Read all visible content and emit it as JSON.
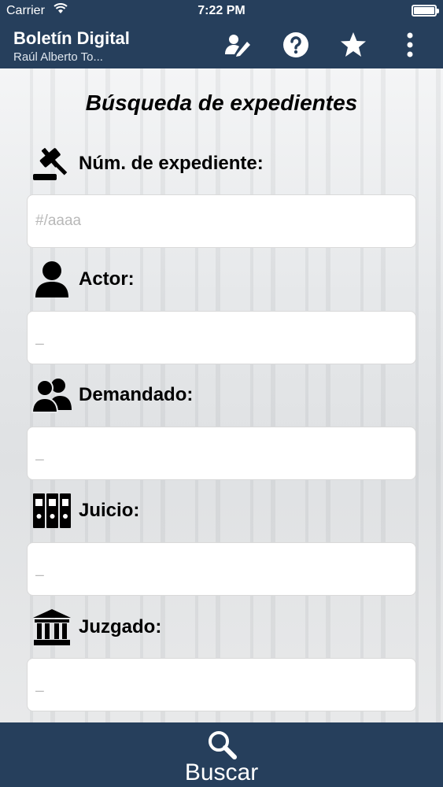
{
  "status_bar": {
    "carrier": "Carrier",
    "time": "7:22 PM"
  },
  "header": {
    "title": "Boletín Digital",
    "subtitle": "Raúl Alberto To...",
    "icons": [
      "edit-icon",
      "help-icon",
      "star-icon",
      "more-icon"
    ]
  },
  "heading": "Búsqueda de expedientes",
  "fields": [
    {
      "label": "Núm. de expediente:",
      "placeholder": "#/aaaa",
      "icon": "gavel-icon"
    },
    {
      "label": "Actor:",
      "placeholder": "_",
      "icon": "person-icon"
    },
    {
      "label": "Demandado:",
      "placeholder": "_",
      "icon": "group-icon"
    },
    {
      "label": "Juicio:",
      "placeholder": "_",
      "icon": "binders-icon"
    },
    {
      "label": "Juzgado:",
      "placeholder": "_",
      "icon": "courthouse-icon"
    }
  ],
  "bottom_bar": {
    "label": "Buscar",
    "icon": "search-icon"
  },
  "colors": {
    "bar": "#263f5c",
    "text": "#000000"
  }
}
